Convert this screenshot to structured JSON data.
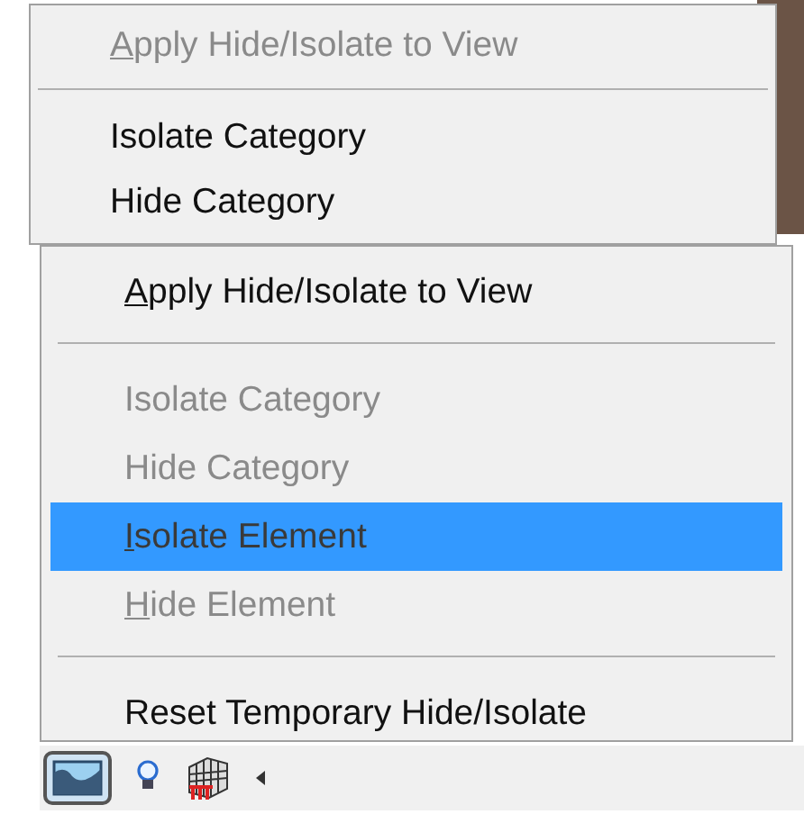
{
  "back_menu": {
    "items": [
      {
        "label": "Apply Hide/Isolate to View",
        "disabled": true,
        "underline_first": true,
        "selected": false
      },
      {
        "kind": "separator"
      },
      {
        "label": "Isolate Category",
        "disabled": false,
        "underline_first": false,
        "selected": false
      },
      {
        "label": "Hide Category",
        "disabled": false,
        "underline_first": false,
        "selected": false
      }
    ]
  },
  "front_menu": {
    "items": [
      {
        "label": "Apply Hide/Isolate to View",
        "disabled": false,
        "underline_first": true,
        "selected": false
      },
      {
        "kind": "separator"
      },
      {
        "label": "Isolate Category",
        "disabled": true,
        "underline_first": false,
        "selected": false
      },
      {
        "label": "Hide Category",
        "disabled": true,
        "underline_first": false,
        "selected": false
      },
      {
        "label": "Isolate Element",
        "disabled": true,
        "underline_first": true,
        "selected": true
      },
      {
        "label": "Hide Element",
        "disabled": true,
        "underline_first": true,
        "selected": false
      },
      {
        "kind": "separator"
      },
      {
        "label": "Reset Temporary Hide/Isolate",
        "disabled": false,
        "underline_first": false,
        "selected": false
      }
    ]
  },
  "toolbar": {
    "buttons": [
      {
        "kind": "hide-isolate",
        "selected": true
      },
      {
        "kind": "lightbulb",
        "selected": false
      },
      {
        "kind": "grid",
        "selected": false
      },
      {
        "kind": "caret",
        "selected": false
      }
    ]
  }
}
